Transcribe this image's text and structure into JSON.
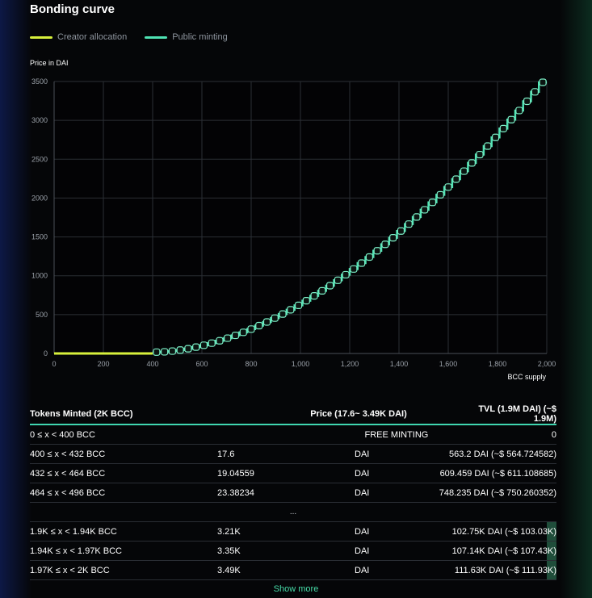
{
  "header": {
    "title": "Bonding curve"
  },
  "legend": [
    {
      "label": "Creator allocation",
      "color": "#d7f03c"
    },
    {
      "label": "Public minting",
      "color": "#4fe3b4"
    }
  ],
  "chart_data": {
    "type": "line",
    "ylabel": "Price in DAI",
    "xlabel": "BCC supply",
    "xlim": [
      0,
      2000
    ],
    "ylim": [
      0,
      3500
    ],
    "x_ticks": [
      "0",
      "200",
      "400",
      "600",
      "800",
      "1,000",
      "1,200",
      "1,400",
      "1,600",
      "1,800",
      "2,000"
    ],
    "y_ticks": [
      "0",
      "500",
      "1000",
      "1500",
      "2000",
      "2500",
      "3000",
      "3500"
    ],
    "grid": true,
    "legend_position": "top-left",
    "series": [
      {
        "name": "Creator allocation",
        "color": "#d7f03c",
        "x": [
          0,
          400
        ],
        "y": [
          0,
          0
        ]
      },
      {
        "name": "Public minting",
        "color": "#4fe3b4",
        "step_start": 400,
        "step_size": 32,
        "steps": 50,
        "start_price": 17.6,
        "end_price": 3490
      }
    ]
  },
  "table": {
    "headers": [
      "Tokens Minted (2K BCC)",
      "Price (17.6~ 3.49K DAI)",
      "TVL (1.9M DAI) (~$ 1.9M)"
    ],
    "first_row": {
      "range": "0 ≤ x < 400 BCC",
      "label": "FREE MINTING",
      "tvl": "0"
    },
    "rows_top": [
      {
        "range": "400 ≤ x < 432 BCC",
        "price": "17.6",
        "unit": "DAI",
        "tvl": "563.2 DAI (~$ 564.724582)"
      },
      {
        "range": "432 ≤ x < 464 BCC",
        "price": "19.04559",
        "unit": "DAI",
        "tvl": "609.459 DAI (~$ 611.108685)"
      },
      {
        "range": "464 ≤ x < 496 BCC",
        "price": "23.38234",
        "unit": "DAI",
        "tvl": "748.235 DAI (~$ 750.260352)"
      }
    ],
    "ellipsis": "...",
    "rows_bottom": [
      {
        "range": "1.9K ≤ x < 1.94K BCC",
        "price": "3.21K",
        "unit": "DAI",
        "tvl": "102.75K DAI (~$ 103.03K)"
      },
      {
        "range": "1.94K ≤ x < 1.97K BCC",
        "price": "3.35K",
        "unit": "DAI",
        "tvl": "107.14K DAI (~$ 107.43K)"
      },
      {
        "range": "1.97K ≤ x < 2K BCC",
        "price": "3.49K",
        "unit": "DAI",
        "tvl": "111.63K DAI (~$ 111.93K)"
      }
    ]
  },
  "footer": {
    "show_more": "Show more"
  }
}
